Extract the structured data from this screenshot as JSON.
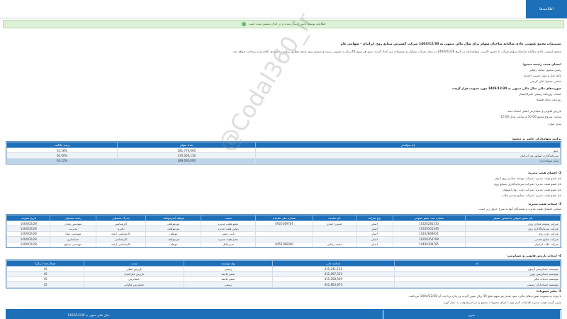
{
  "topbar": {
    "tab_label": "اطلاعیه‌ها"
  },
  "notice": {
    "text": "اطلاعیه توسط ناشر ارسال شده و در کدال منتشر شده است",
    "icon": "check-icon"
  },
  "heading": "تصمیمات مجمع عمومی عادی سالیانه صاحبان سهام برای سال مالی منتهی به 1403/12/30 شرکت گسترش صنایع روی ایرانیان - سهامی عام",
  "lines": [
    "مجمع عمومی عادی سالیانه صاحبان سهام شرکت با حضور اکثریت سهامداران در تاریخ 1404/02/28 در محل شرکت تشکیل و تصمیمات زیر اتخاذ گردید. سود هر سهم 40 ریال به تصویب رسید و تقسیم سود نقدی مطابق برنامه زمان‌بندی اعلام شده پرداخت خواهد شد.",
    "اعضای هیئت رئیسه مجمع:",
    "رئیس مجمع: محمد رضایی",
    "ناظر اول و دوم: حسین احمدی",
    "منشی مجمع: علی کریمی",
    "صورت‌های مالی سال مالی منتهی به 1403/12/30 مورد تصویب قرار گرفت",
    "انتخاب روزنامه رسمی کثیرالانتشار",
    "روزنامه دنیای اقتصاد",
    "بازرس قانونی و حسابرس اصلی انتخاب شد",
    "ساعت شروع مجمع 10:00 و ساعت پایان 12:00",
    "سایر موارد"
  ],
  "table1": {
    "section_title": "ترکیب سهامداران حاضر در مجمع:",
    "headers": [
      "نام سهامدار",
      "تعداد سهام",
      "درصد مالکیت"
    ],
    "rows": [
      [
        "جمع",
        "281,779,000",
        "62.58%"
      ],
      [
        "سرمایه‌گذاری صنایع روی ایرانیان",
        "270,000,130",
        "60.00%"
      ],
      [
        "سایر سهامداران",
        "289,000,000",
        "64.22%"
      ]
    ]
  },
  "section2": {
    "title": "2- اعضای هیئت مدیره:",
    "items": [
      "نام عضو هیئت مدیره: شرکت توسعه معادن روی ایران",
      "نام عضو هیئت مدیره: شرکت سرمایه‌گذاری صنایع روی",
      "نام عضو هیئت مدیره: شرکت ذوب روی اصفهان",
      "نام عضو هیئت مدیره: شرکت صنایع معدنی فلات"
    ]
  },
  "section3": {
    "title": "3- انتخاب هیئت مدیره:",
    "note": "اسامی اعضای هیئت مدیره و نمایندگان آنها به شرح جدول زیر است:"
  },
  "table2": {
    "headers": [
      "نام عضو حقوقی یا شخص حقیقی",
      "شماره ثبت عضو حقوقی",
      "نوع شرکت",
      "نام نماینده",
      "شماره ملی نماینده",
      "سمت",
      "موظف/غیرموظف",
      "مدرک تحصیلی",
      "رشته تحصیلی",
      "تاریخ تصویب"
    ],
    "rows": [
      [
        "شرکت توسعه معادن روی",
        "10320285333",
        "اصلی",
        "حسین احمدی",
        "0920349787",
        "عضو هیئت مدیره",
        "غیرموظف",
        "کارشناسی",
        "مهندسی معدن",
        "1404/02/28"
      ],
      [
        "شرکت سرمایه‌گذاری روی",
        "10320501340",
        "اصلی",
        "",
        "",
        "رئیس هیئت مدیره",
        "غیرموظف",
        "دکتری",
        "مدیریت",
        "1404/02/28"
      ],
      [
        "شرکت ذوب روی",
        "10102848921",
        "اصلی",
        "",
        "",
        "نایب رئیس",
        "موظف",
        "کارشناسی ارشد",
        "مهندسی مواد",
        "1404/02/28"
      ],
      [
        "شرکت صنایع معدنی",
        "10320354799",
        "اصلی",
        "",
        "",
        "عضو هیئت مدیره",
        "غیرموظف",
        "کارشناسی",
        "حسابداری",
        "1404/02/28"
      ],
      [
        "شرکت فلات ایرانیان",
        "10400308785",
        "اصلی",
        "محمد رضایی",
        "0452186000",
        "مدیرعامل",
        "موظف",
        "کارشناسی ارشد",
        "مهندسی صنایع",
        "1404/02/28"
      ]
    ]
  },
  "section4": {
    "title": "4- انتخاب بازرس قانونی و حسابرس:"
  },
  "table3": {
    "headers": [
      "نام",
      "شناسه ملی",
      "نوع مؤسسه",
      "سمت",
      "حق‌الزحمه (ریال)"
    ],
    "rows": [
      [
        "مؤسسه حسابرسی آزمون",
        "411,241,141",
        "رسمی",
        "بازرس اصلی",
        "45"
      ],
      [
        "مؤسسه حسابرسی نوین",
        "411,097,552",
        "عضو جامعه",
        "بازرس علی‌البدل",
        "45"
      ],
      [
        "مؤسسه خدمات مالی",
        "411,208,549",
        "عضو جامعه",
        "حسابرس",
        "45"
      ],
      [
        "مؤسسه حسابداران رسمی",
        "441,863,870",
        "رسمی",
        "حسابرس مالیاتی",
        "45"
      ]
    ]
  },
  "section5": {
    "title": "5- سایر مصوبات:",
    "lines": [
      "با توجه به تصویب صورت‌های مالی، سود نقدی هر سهم مبلغ 40 ریال تعیین گردید و زمان پرداخت آن 1404/12/28 می‌باشد.",
      "مقرر گردید هیئت مدیره اقدامات لازم جهت اجرای مصوبات مجمع را در اسرع وقت به عمل آورد."
    ]
  },
  "bottom": {
    "col_title": "شرح",
    "date_label": "سال مالی منتهی به 1403/12/30"
  },
  "watermark": "@Codal360_ir",
  "colors": {
    "primary": "#1d6fb8",
    "notice_bg": "#dff0d8",
    "row_alt": "#eef3f8",
    "row_selected": "#bcd6ec"
  }
}
